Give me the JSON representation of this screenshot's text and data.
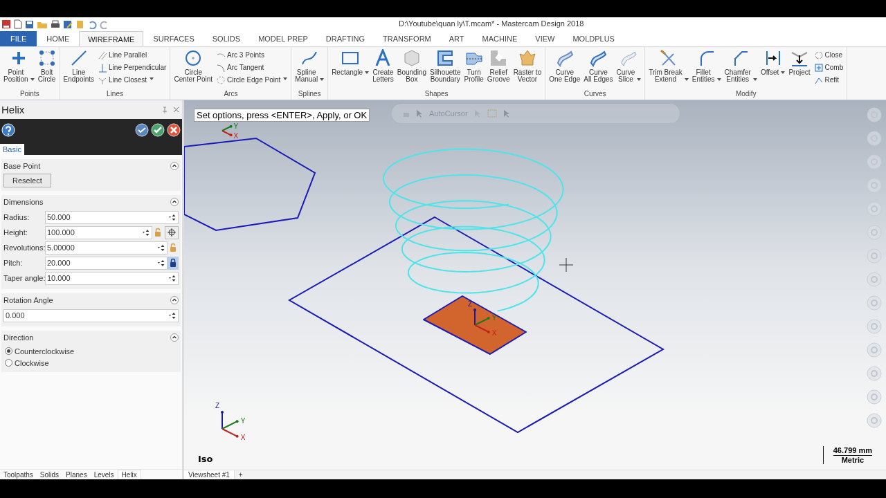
{
  "title_bar": {
    "title": "D:\\Youtube\\quan ly\\T.mcam* - Mastercam Design 2018"
  },
  "ribbon_tabs": [
    {
      "label": "FILE",
      "kind": "file",
      "selected": false
    },
    {
      "label": "HOME",
      "kind": "tab",
      "selected": false
    },
    {
      "label": "WIREFRAME",
      "kind": "tab",
      "selected": true
    },
    {
      "label": "SURFACES",
      "kind": "tab",
      "selected": false
    },
    {
      "label": "SOLIDS",
      "kind": "tab",
      "selected": false
    },
    {
      "label": "MODEL PREP",
      "kind": "tab",
      "selected": false
    },
    {
      "label": "DRAFTING",
      "kind": "tab",
      "selected": false
    },
    {
      "label": "TRANSFORM",
      "kind": "tab",
      "selected": false
    },
    {
      "label": "ART",
      "kind": "tab",
      "selected": false
    },
    {
      "label": "MACHINE",
      "kind": "tab",
      "selected": false
    },
    {
      "label": "VIEW",
      "kind": "tab",
      "selected": false
    },
    {
      "label": "MOLDPLUS",
      "kind": "tab",
      "selected": false
    }
  ],
  "ribbon_groups": [
    {
      "label": "Points",
      "items": [
        {
          "label": "Point\nPosition",
          "kind": "large",
          "dropdown": true
        },
        {
          "label": "Bolt\nCircle",
          "kind": "large",
          "dropdown": false
        }
      ]
    },
    {
      "label": "Lines",
      "items": [
        {
          "label": "Line\nEndpoints",
          "kind": "large",
          "dropdown": false
        },
        {
          "label": "Line Parallel",
          "kind": "small",
          "dropdown": false
        },
        {
          "label": "Line Perpendicular",
          "kind": "small",
          "dropdown": false
        },
        {
          "label": "Line Closest",
          "kind": "small",
          "dropdown": true
        }
      ]
    },
    {
      "label": "Arcs",
      "items": [
        {
          "label": "Circle\nCenter Point",
          "kind": "large",
          "dropdown": false
        },
        {
          "label": "Arc 3 Points",
          "kind": "small",
          "dropdown": false
        },
        {
          "label": "Arc Tangent",
          "kind": "small",
          "dropdown": false
        },
        {
          "label": "Circle Edge Point",
          "kind": "small",
          "dropdown": true
        }
      ]
    },
    {
      "label": "Splines",
      "items": [
        {
          "label": "Spline\nManual",
          "kind": "large",
          "dropdown": true
        }
      ]
    },
    {
      "label": "Shapes",
      "items": [
        {
          "label": "Rectangle",
          "kind": "large",
          "dropdown": true
        },
        {
          "label": "Create\nLetters",
          "kind": "large",
          "dropdown": false
        },
        {
          "label": "Bounding\nBox",
          "kind": "large",
          "dropdown": false
        },
        {
          "label": "Silhouette\nBoundary",
          "kind": "large",
          "dropdown": false
        },
        {
          "label": "Turn\nProfile",
          "kind": "large",
          "dropdown": false
        },
        {
          "label": "Relief\nGroove",
          "kind": "large",
          "dropdown": false
        },
        {
          "label": "Raster to\nVector",
          "kind": "large",
          "dropdown": false
        }
      ]
    },
    {
      "label": "Curves",
      "items": [
        {
          "label": "Curve\nOne Edge",
          "kind": "large",
          "dropdown": false
        },
        {
          "label": "Curve\nAll Edges",
          "kind": "large",
          "dropdown": false
        },
        {
          "label": "Curve\nSlice",
          "kind": "large",
          "dropdown": true
        }
      ]
    },
    {
      "label": "Modify",
      "items": [
        {
          "label": "Trim Break\nExtend",
          "kind": "large",
          "dropdown": true
        },
        {
          "label": "Fillet\nEntities",
          "kind": "large",
          "dropdown": true
        },
        {
          "label": "Chamfer\nEntities",
          "kind": "large",
          "dropdown": true
        },
        {
          "label": "Offset",
          "kind": "large",
          "dropdown": true
        },
        {
          "label": "Project",
          "kind": "large",
          "dropdown": false
        },
        {
          "label": "Close",
          "kind": "small",
          "dropdown": false
        },
        {
          "label": "Comb",
          "kind": "small",
          "dropdown": false
        },
        {
          "label": "Refit",
          "kind": "small",
          "dropdown": false
        }
      ]
    }
  ],
  "panel": {
    "title": "Helix",
    "tab": "Basic",
    "base_point": {
      "title": "Base Point",
      "button": "Reselect"
    },
    "dimensions": {
      "title": "Dimensions",
      "fields": [
        {
          "label": "Radius:",
          "value": "50.000"
        },
        {
          "label": "Height:",
          "value": "100.000",
          "locked": false,
          "pick": true
        },
        {
          "label": "Revolutions:",
          "value": "5.00000",
          "locked": false
        },
        {
          "label": "Pitch:",
          "value": "20.000",
          "locked": true
        },
        {
          "label": "Taper angle:",
          "value": "10.000"
        }
      ]
    },
    "rotation": {
      "title": "Rotation Angle",
      "value": "0.000"
    },
    "direction": {
      "title": "Direction",
      "options": [
        {
          "label": "Counterclockwise",
          "selected": true
        },
        {
          "label": "Clockwise",
          "selected": false
        }
      ]
    }
  },
  "manager_tabs": [
    {
      "label": "Toolpaths",
      "selected": false
    },
    {
      "label": "Solids",
      "selected": false
    },
    {
      "label": "Planes",
      "selected": false
    },
    {
      "label": "Levels",
      "selected": false
    },
    {
      "label": "Helix",
      "selected": true
    }
  ],
  "viewport": {
    "prompt": "Set options, press <ENTER>, Apply, or OK",
    "autocursor": "AutoCursor",
    "gnomons": [
      {
        "labels": [
          "Y",
          "X"
        ]
      },
      {
        "labels": [
          "Z",
          "Y",
          "X"
        ]
      },
      {
        "labels": [
          "Z",
          "Y",
          "X"
        ]
      }
    ],
    "view_name": "Iso",
    "scale": {
      "value": "46.799 mm",
      "unit": "Metric"
    }
  },
  "viewsheets": [
    {
      "label": "Viewsheet #1",
      "selected": true
    },
    {
      "label": "+",
      "selected": false
    }
  ]
}
